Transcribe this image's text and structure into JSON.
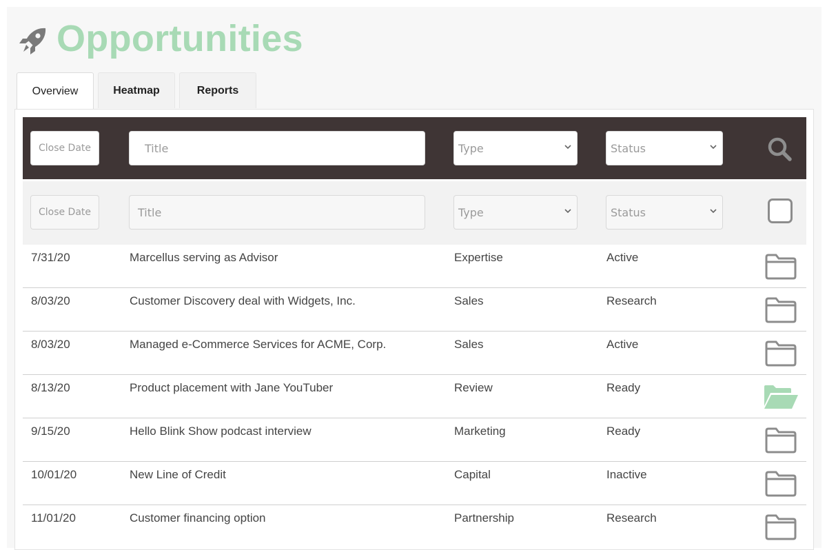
{
  "app": {
    "title": "Opportunities",
    "accent": "#a8dab5"
  },
  "tabs": [
    {
      "label": "Overview",
      "active": true
    },
    {
      "label": "Heatmap",
      "active": false
    },
    {
      "label": "Reports",
      "active": false
    }
  ],
  "filters": {
    "primary": {
      "close_date": "Close Date",
      "title": "Title",
      "type": "Type",
      "status": "Status"
    },
    "secondary": {
      "close_date": "Close Date",
      "title": "Title",
      "type": "Type",
      "status": "Status"
    }
  },
  "rows": [
    {
      "date": "7/31/20",
      "title": "Marcellus serving as Advisor",
      "type": "Expertise",
      "status": "Active",
      "folder": "closed"
    },
    {
      "date": "8/03/20",
      "title": "Customer Discovery deal with Widgets, Inc.",
      "type": "Sales",
      "status": "Research",
      "folder": "closed"
    },
    {
      "date": "8/03/20",
      "title": "Managed e-Commerce Services for ACME, Corp.",
      "type": "Sales",
      "status": "Active",
      "folder": "closed"
    },
    {
      "date": "8/13/20",
      "title": "Product placement with Jane YouTuber",
      "type": "Review",
      "status": "Ready",
      "folder": "open"
    },
    {
      "date": "9/15/20",
      "title": "Hello Blink Show podcast interview",
      "type": "Marketing",
      "status": "Ready",
      "folder": "closed"
    },
    {
      "date": "10/01/20",
      "title": "New Line of Credit",
      "type": "Capital",
      "status": "Inactive",
      "folder": "closed"
    },
    {
      "date": "11/01/20",
      "title": "Customer financing option",
      "type": "Partnership",
      "status": "Research",
      "folder": "closed"
    }
  ]
}
